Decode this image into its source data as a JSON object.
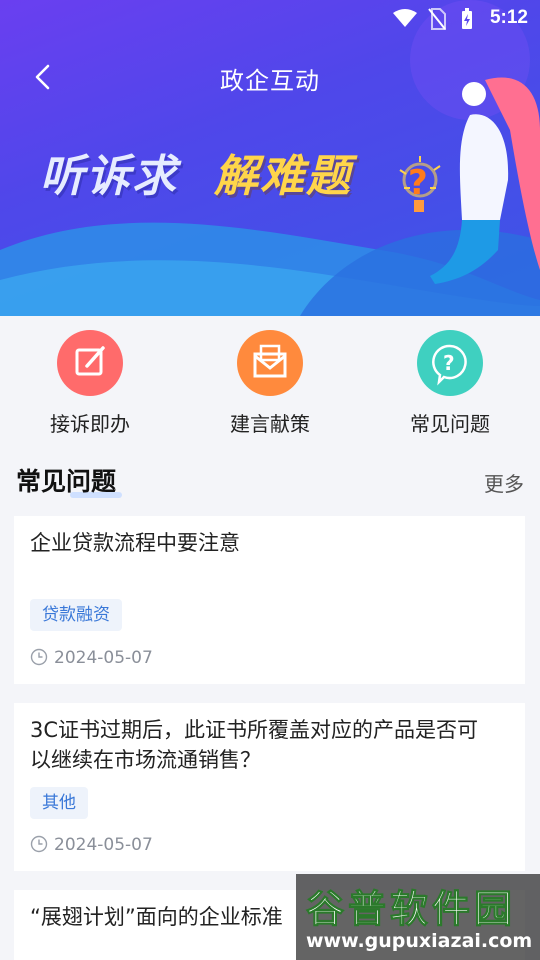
{
  "status_bar": {
    "time": "5:12"
  },
  "header": {
    "title": "政企互动"
  },
  "banner": {
    "slogan_left": "听诉求",
    "slogan_right": "解难题"
  },
  "actions": [
    {
      "label": "接诉即办",
      "icon": "edit-icon",
      "color": "#ff6b6b"
    },
    {
      "label": "建言献策",
      "icon": "mail-icon",
      "color": "#ff8a3d"
    },
    {
      "label": "常见问题",
      "icon": "question-icon",
      "color": "#3fd0c0"
    }
  ],
  "section": {
    "title": "常见问题",
    "more": "更多"
  },
  "cards": [
    {
      "question": "企业贷款流程中要注意",
      "tag": "贷款融资",
      "date": "2024-05-07"
    },
    {
      "question": "3C证书过期后，此证书所覆盖对应的产品是否可以继续在市场流通销售？",
      "tag": "其他",
      "date": "2024-05-07"
    },
    {
      "question": "“展翅计划”面向的企业标准"
    }
  ],
  "watermark": {
    "name": "谷普软件园",
    "url": "www.gupuxiazai.com"
  }
}
